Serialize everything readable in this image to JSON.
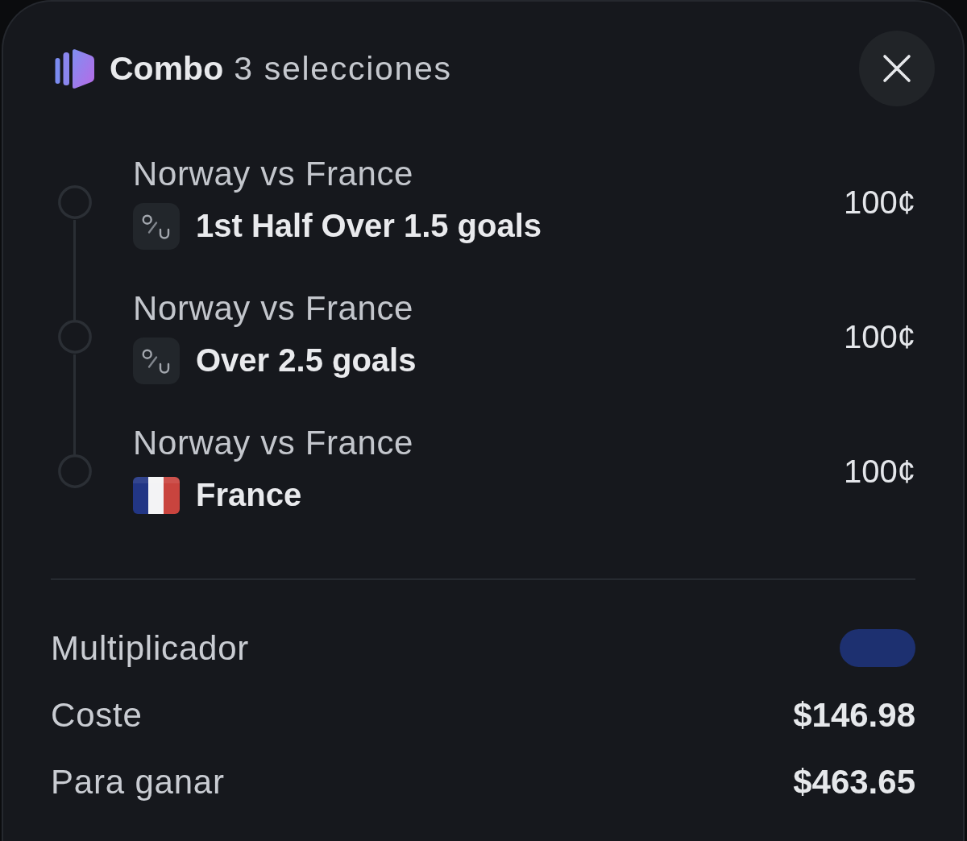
{
  "header": {
    "title": "Combo",
    "count": "3 selecciones"
  },
  "selections": [
    {
      "match": "Norway vs France",
      "kind": "total",
      "market": "1st Half Over 1.5 goals",
      "price": "100¢"
    },
    {
      "match": "Norway vs France",
      "kind": "total",
      "market": "Over 2.5 goals",
      "price": "100¢"
    },
    {
      "match": "Norway vs France",
      "kind": "team",
      "market": "France",
      "price": "100¢"
    }
  ],
  "summary": [
    {
      "label": "Multiplicador",
      "kind": "pill"
    },
    {
      "label": "Coste",
      "kind": "amount",
      "value": "$146.98"
    },
    {
      "label": "Para ganar",
      "kind": "amount",
      "value": "$463.65"
    }
  ]
}
